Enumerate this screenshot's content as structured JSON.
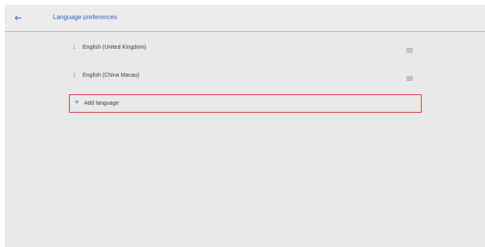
{
  "appbar": {
    "title": "Language preferences",
    "back_icon": "arrow-left-icon"
  },
  "languages": [
    {
      "number": "1",
      "name": "English (United Kingdom)",
      "handle_icon": "drag-handle-icon"
    },
    {
      "number": "2",
      "name": "English (China Macau)",
      "handle_icon": "drag-handle-icon"
    }
  ],
  "add_language": {
    "label": "Add language",
    "icon": "plus-icon"
  },
  "colors": {
    "background": "#e9e9e9",
    "accent": "#2f63c8",
    "highlight_border": "#e0313a"
  }
}
